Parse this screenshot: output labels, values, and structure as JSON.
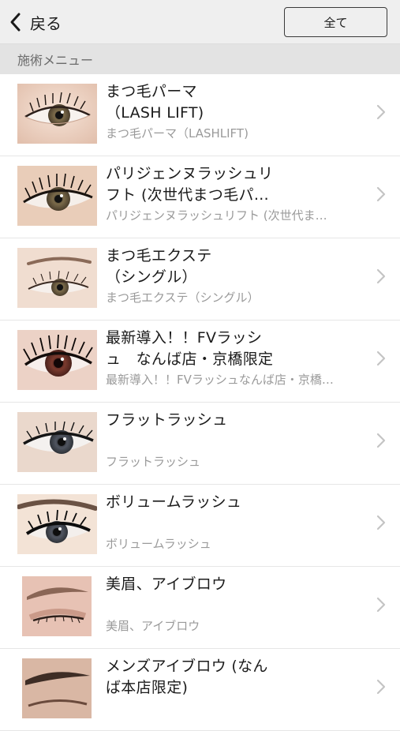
{
  "header": {
    "back_label": "戻る",
    "all_button": "全て"
  },
  "section": {
    "title": "施術メニュー"
  },
  "menu": [
    {
      "title": "まつ毛パーマ\n（LASH LIFT)",
      "subtitle": "まつ毛パーマ（LASHLIFT)"
    },
    {
      "title": "パリジェンヌラッシュリ\nフト (次世代まつ毛パ…",
      "subtitle": "パリジェンヌラッシュリフト (次世代ま…"
    },
    {
      "title": "まつ毛エクステ\n（シングル）",
      "subtitle": "まつ毛エクステ（シングル）"
    },
    {
      "title": "最新導入！！FVラッシ\nュ　なんば店・京橋限定",
      "subtitle": "最新導入！！FVラッシュなんば店・京橋…"
    },
    {
      "title": "フラットラッシュ",
      "subtitle": "フラットラッシュ"
    },
    {
      "title": "ボリュームラッシュ",
      "subtitle": "ボリュームラッシュ"
    },
    {
      "title": "美眉、アイブロウ",
      "subtitle": "美眉、アイブロウ"
    },
    {
      "title": "メンズアイブロウ (なん\nば本店限定)",
      "subtitle": ""
    }
  ],
  "icons": {
    "back": "chevron-left-icon",
    "row_arrow": "chevron-right-icon"
  },
  "colors": {
    "header_bg": "#efefef",
    "section_bg": "#e3e3e3",
    "subtitle": "#9a9a9a",
    "chevron": "#c4c4c4"
  }
}
